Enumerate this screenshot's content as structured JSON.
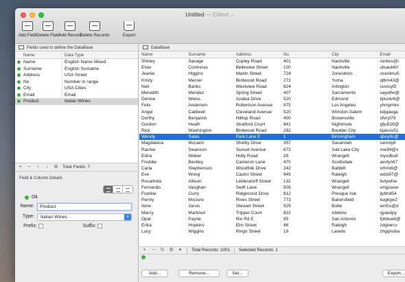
{
  "window": {
    "title": "Untitled",
    "edited": "— Edited ⌄"
  },
  "toolbar": {
    "add_field": "Add Field",
    "delete_field": "Delete Field",
    "add_record": "Add Record",
    "delete_records": "Delete Records",
    "export": "Export"
  },
  "fields_pane": {
    "header": "Fields used to define the DataBase",
    "col_name": "Name",
    "col_type": "Data Type",
    "rows": [
      {
        "name": "Name",
        "type": "English Name Mixed"
      },
      {
        "name": "Surname",
        "type": "English Surname"
      },
      {
        "name": "Address",
        "type": "USA Street"
      },
      {
        "name": "No",
        "type": "Number in range"
      },
      {
        "name": "City",
        "type": "USA Cities"
      },
      {
        "name": "Email",
        "type": "Email"
      },
      {
        "name": "Product",
        "type": "Italian Wines"
      }
    ],
    "total_fields": "Total Fields: 7"
  },
  "details": {
    "header": "Field & Column Details",
    "status": "Ok",
    "name_label": "Name:",
    "name_value": "Product",
    "type_label": "Type:",
    "type_value": "Italian Wines",
    "prefix_label": "Prefix:",
    "suffix_label": "Suffix:"
  },
  "database": {
    "header": "DataBase",
    "columns": [
      "Name",
      "Surname",
      "Address",
      "No",
      "City",
      "Email"
    ],
    "rows": [
      [
        "Shirley",
        "Savage",
        "Copley Road",
        "401",
        "Nashville",
        "ronkes@i"
      ],
      [
        "Elsie",
        "Contreras",
        "Belleview Street",
        "100",
        "Nashville",
        "utoauk60"
      ],
      [
        "Jeanie",
        "Higgins",
        "Martin Street",
        "724",
        "Jonesboro",
        "oceolmu5"
      ],
      [
        "Kristy",
        "Mercer",
        "Birdwood Road",
        "272",
        "Yuma",
        "qtbm43@"
      ],
      [
        "Neil",
        "Banks",
        "Westview Road",
        "824",
        "Arlington",
        "vuvioyt5"
      ],
      [
        "Meredith",
        "Mendez",
        "Spring Street",
        "407",
        "Sacramento",
        "vayutfw@"
      ],
      [
        "Denise",
        "Weiss",
        "Azalea Drive",
        "520",
        "Edmond",
        "bjkudv4@"
      ],
      [
        "Felix",
        "Andersen",
        "Robertson Avenue",
        "975",
        "Los Angeles",
        "yhmpmkv"
      ],
      [
        "Angel",
        "Caldwell",
        "Cleveland Avenue",
        "520",
        "Winston-Salem",
        "kdjqauga"
      ],
      [
        "Dorthy",
        "Benjamin",
        "Hilltop Road",
        "400",
        "Brownsville",
        "nfvryt79"
      ],
      [
        "Gordon",
        "Heath",
        "Stratford Court",
        "841",
        "Nightmute",
        "gfju528@"
      ],
      [
        "Rick",
        "Washington",
        "Birdwood Road",
        "282",
        "Boulder City",
        "kjaisvu51"
      ],
      [
        "Wendy",
        "Salas",
        "Park Lane E",
        "1",
        "Birmingham",
        "qboy9c@"
      ],
      [
        "Magdalena",
        "Mccann",
        "Shelby Drive",
        "357",
        "Savannah",
        "vanrdy8"
      ],
      [
        "Rachel",
        "Swanson",
        "Sunset Avenue",
        "672",
        "Salt Lake City",
        "mwif4@x"
      ],
      [
        "Edna",
        "Weber",
        "Holly Road",
        "28",
        "Wrangell",
        "myvdbu8"
      ],
      [
        "Freddie",
        "Bentley",
        "Cameron Lane",
        "470",
        "Scottsdale",
        "axvfyn67"
      ],
      [
        "Carla",
        "Stephenson",
        "Woodfolk Drive",
        "242",
        "Babbitt",
        "xrhmi6@"
      ],
      [
        "Eve",
        "Wong",
        "Castro Street",
        "945",
        "Raleigh",
        "wdsi97@"
      ],
      [
        "Rosalinda",
        "Allison",
        "Leidesdorff Street",
        "132",
        "Wrangell",
        "bvtywhw"
      ],
      [
        "Fernando",
        "Vaughan",
        "Swift Lane",
        "505",
        "Wrangell",
        "vmgcaxw"
      ],
      [
        "Frankie",
        "Curry",
        "Ridgecrest Drive",
        "812",
        "Presque Isle",
        "jlybhd54"
      ],
      [
        "Penny",
        "Mcclure",
        "Rives Street",
        "773",
        "Bakersfield",
        "kugkgw2"
      ],
      [
        "Ilene",
        "Jarvis",
        "Stewart Street",
        "929",
        "Butte",
        "wnfzu@d"
      ],
      [
        "Marcy",
        "Martinez",
        "Tripper Court",
        "822",
        "Abilene",
        "qyaedpy"
      ],
      [
        "Opal",
        "Payne",
        "Rio Rd E",
        "95",
        "San Antonio",
        "fphbue8@"
      ],
      [
        "Erika",
        "Hopkins",
        "Elm Street",
        "46",
        "Raleigh",
        "zdgiwrcv"
      ],
      [
        "Lucy",
        "Wiggins",
        "Ringo Street",
        "19",
        "Laredo",
        "zhgqnoba"
      ]
    ],
    "selected_index": 12,
    "total_records": "Total Records: 1001",
    "selected_records": "Selected Records: 1"
  },
  "buttons": {
    "add": "Add...",
    "remove": "Remove...",
    "set": "Set...",
    "export": "Export..."
  },
  "colors": {
    "selection": "#1f6fe0",
    "ok": "#3fae3a",
    "accent": "#3b82f6"
  }
}
